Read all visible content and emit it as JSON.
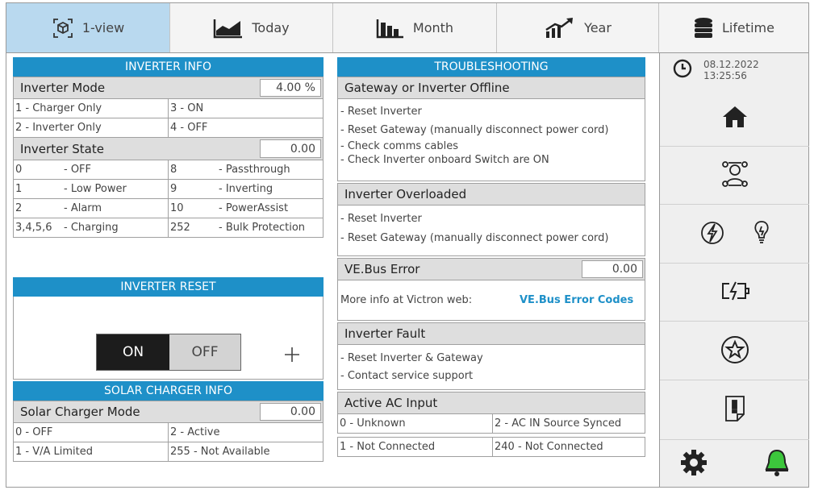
{
  "tabs": [
    {
      "label": "1-view",
      "icon": "cube-icon",
      "active": true
    },
    {
      "label": "Today",
      "icon": "area-chart-icon",
      "active": false
    },
    {
      "label": "Month",
      "icon": "bar-chart-icon",
      "active": false
    },
    {
      "label": "Year",
      "icon": "trend-up-icon",
      "active": false
    },
    {
      "label": "Lifetime",
      "icon": "coins-icon",
      "active": false
    }
  ],
  "inverter_info": {
    "title": "INVERTER INFO",
    "mode_label": "Inverter Mode",
    "mode_value": "4.00 %",
    "modes": [
      [
        "1 - Charger Only",
        "3 - ON"
      ],
      [
        "2 - Inverter Only",
        "4 - OFF"
      ]
    ],
    "state_label": "Inverter State",
    "state_value": "0.00",
    "states": [
      [
        [
          "0",
          "- OFF"
        ],
        [
          "8",
          "- Passthrough"
        ]
      ],
      [
        [
          "1",
          "- Low Power"
        ],
        [
          "9",
          "- Inverting"
        ]
      ],
      [
        [
          "2",
          "- Alarm"
        ],
        [
          "10",
          "- PowerAssist"
        ]
      ],
      [
        [
          "3,4,5,6",
          "- Charging"
        ],
        [
          "252",
          "- Bulk Protection"
        ]
      ]
    ]
  },
  "inverter_reset": {
    "title": "INVERTER RESET",
    "on_label": "ON",
    "off_label": "OFF"
  },
  "solar": {
    "title": "SOLAR CHARGER INFO",
    "mode_label": "Solar Charger Mode",
    "mode_value": "0.00",
    "modes": [
      [
        "0 - OFF",
        "2 - Active"
      ],
      [
        "1 - V/A Limited",
        "255 - Not Available"
      ]
    ]
  },
  "troubleshooting": {
    "title": "TROUBLESHOOTING",
    "offline_label": "Gateway or Inverter Offline",
    "offline_lines": [
      "- Reset Inverter",
      "- Reset Gateway (manually disconnect power cord)",
      "- Check comms cables",
      "- Check Inverter onboard Switch are ON"
    ],
    "overloaded_label": "Inverter Overloaded",
    "overloaded_lines": [
      "- Reset Inverter",
      "- Reset Gateway (manually disconnect power cord)"
    ],
    "vebus_label": "VE.Bus Error",
    "vebus_value": "0.00",
    "vebus_info": "More info at Victron web:",
    "vebus_link": "VE.Bus Error Codes",
    "fault_label": "Inverter Fault",
    "fault_lines": [
      "- Reset Inverter & Gateway",
      "- Contact service support"
    ],
    "ac_label": "Active AC Input",
    "ac_rows": [
      [
        "0 - Unknown",
        "2 - AC IN Source Synced"
      ],
      [
        "1 - Not Connected",
        "240 - Not Connected"
      ]
    ]
  },
  "sidebar": {
    "date": "08.12.2022",
    "time": "13:25:56",
    "items": [
      "home-icon",
      "user-scan-icon",
      "lightning-icon",
      "lightbulb-icon",
      "battery-charging-icon",
      "star-icon",
      "document-alert-icon",
      "gear-icon",
      "bell-icon"
    ]
  },
  "colors": {
    "header_blue": "#1e90c8",
    "active_tab": "#b9d9ef",
    "bell_green": "#3cc63c"
  }
}
